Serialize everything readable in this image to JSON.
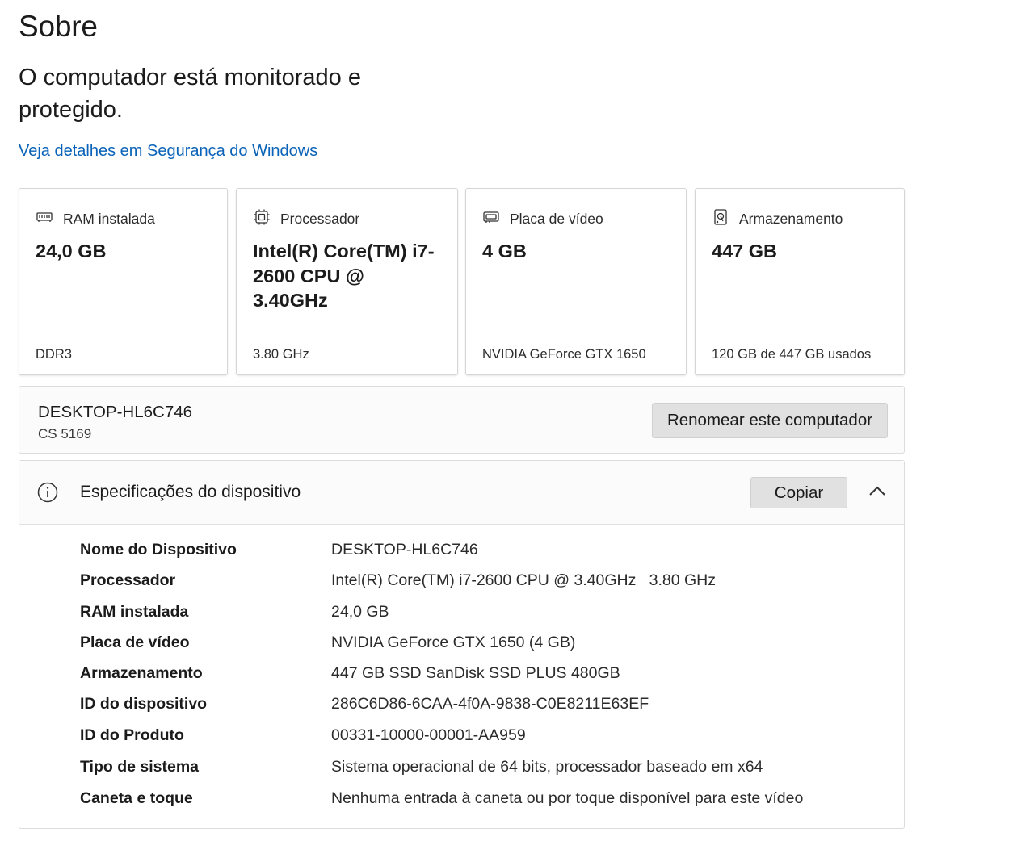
{
  "page": {
    "title": "Sobre",
    "status": "O computador está monitorado e protegido.",
    "security_link": "Veja detalhes em Segurança do Windows"
  },
  "cards": [
    {
      "label": "RAM instalada",
      "value": "24,0 GB",
      "detail": "DDR3",
      "icon": "ram-icon"
    },
    {
      "label": "Processador",
      "value": "Intel(R) Core(TM) i7-2600 CPU @ 3.40GHz",
      "detail": "3.80 GHz",
      "icon": "cpu-icon"
    },
    {
      "label": "Placa de vídeo",
      "value": "4 GB",
      "detail": "NVIDIA GeForce GTX 1650",
      "icon": "gpu-icon"
    },
    {
      "label": "Armazenamento",
      "value": "447 GB",
      "detail": "120 GB de 447 GB usados",
      "icon": "storage-icon"
    }
  ],
  "device": {
    "name": "DESKTOP-HL6C746",
    "model": "CS 5169",
    "rename_label": "Renomear este computador"
  },
  "specs": {
    "title": "Especificações do dispositivo",
    "copy_label": "Copiar",
    "rows": [
      {
        "label": "Nome do Dispositivo",
        "value": "DESKTOP-HL6C746"
      },
      {
        "label": "Processador",
        "value": "Intel(R) Core(TM) i7-2600 CPU @ 3.40GHz   3.80 GHz"
      },
      {
        "label": "RAM instalada",
        "value": "24,0 GB"
      },
      {
        "label": "Placa de vídeo",
        "value": "NVIDIA GeForce GTX 1650 (4 GB)"
      },
      {
        "label": "Armazenamento",
        "value": "447 GB SSD SanDisk SSD PLUS 480GB"
      },
      {
        "label": "ID do dispositivo",
        "value": "286C6D86-6CAA-4f0A-9838-C0E8211E63EF"
      },
      {
        "label": "ID do Produto",
        "value": "00331-10000-00001-AA959"
      },
      {
        "label": "Tipo de sistema",
        "value": "Sistema operacional de 64 bits, processador baseado em x64"
      },
      {
        "label": "Caneta e toque",
        "value": "Nenhuma entrada à caneta ou por toque disponível para este vídeo"
      }
    ]
  },
  "colors": {
    "link": "#0a63b8",
    "button_bg": "#e1e1e1",
    "border": "#dcdcdc"
  }
}
